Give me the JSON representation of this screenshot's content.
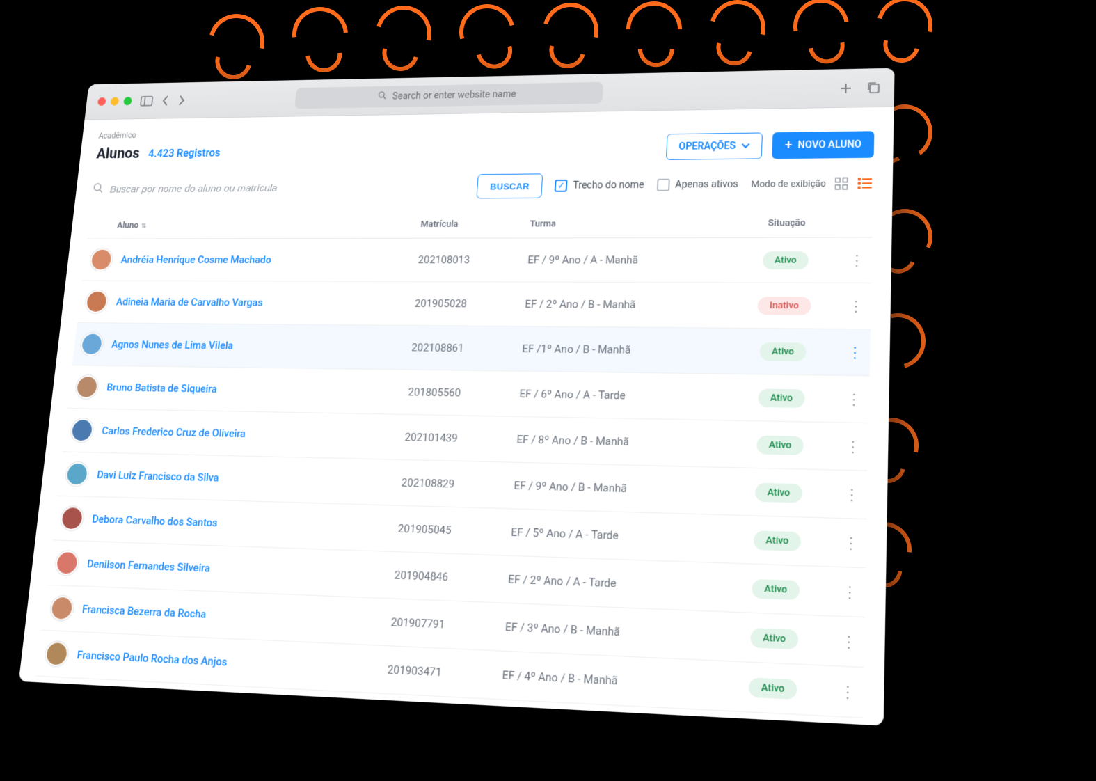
{
  "browser": {
    "address_placeholder": "Search or enter website name"
  },
  "header": {
    "breadcrumb": "Acadêmico",
    "title": "Alunos",
    "count": "4.423 Registros",
    "operations_label": "OPERAÇÕES",
    "new_label": "NOVO ALUNO"
  },
  "toolbar": {
    "search_placeholder": "Buscar por nome do aluno ou matrícula",
    "search_button": "BUSCAR",
    "chk_trecho": "Trecho do nome",
    "chk_ativos": "Apenas ativos",
    "viewmode_label": "Modo de exibição"
  },
  "columns": {
    "aluno": "Aluno",
    "matricula": "Matrícula",
    "turma": "Turma",
    "situacao": "Situação"
  },
  "status_labels": {
    "ativo": "Ativo",
    "inativo": "Inativo"
  },
  "rows": [
    {
      "name": "Andréia Henrique Cosme Machado",
      "matricula": "202108013",
      "turma": "EF / 9º Ano / A - Manhã",
      "status": "ativo",
      "selected": false,
      "avatar": "#d98c6a"
    },
    {
      "name": "Adineia Maria de Carvalho Vargas",
      "matricula": "201905028",
      "turma": "EF / 2º Ano / B - Manhã",
      "status": "inativo",
      "selected": false,
      "avatar": "#c97a52"
    },
    {
      "name": "Agnos Nunes de Lima Vilela",
      "matricula": "202108861",
      "turma": "EF /1º Ano / B - Manhã",
      "status": "ativo",
      "selected": true,
      "avatar": "#6aa8d9"
    },
    {
      "name": "Bruno Batista de Siqueira",
      "matricula": "201805560",
      "turma": "EF / 6º Ano / A - Tarde",
      "status": "ativo",
      "selected": false,
      "avatar": "#b88a6a"
    },
    {
      "name": "Carlos Frederico Cruz de Oliveira",
      "matricula": "202101439",
      "turma": "EF / 8º Ano / B - Manhã",
      "status": "ativo",
      "selected": false,
      "avatar": "#4a7ab0"
    },
    {
      "name": "Davi Luiz Francisco da Silva",
      "matricula": "202108829",
      "turma": "EF / 9º Ano / B - Manhã",
      "status": "ativo",
      "selected": false,
      "avatar": "#5aa7c9"
    },
    {
      "name": "Debora Carvalho dos Santos",
      "matricula": "201905045",
      "turma": "EF / 5º Ano / A - Tarde",
      "status": "ativo",
      "selected": false,
      "avatar": "#a8544c"
    },
    {
      "name": "Denilson Fernandes Silveira",
      "matricula": "201904846",
      "turma": "EF / 2º Ano / A - Tarde",
      "status": "ativo",
      "selected": false,
      "avatar": "#d9786a"
    },
    {
      "name": "Francisca Bezerra da Rocha",
      "matricula": "201907791",
      "turma": "EF / 3º Ano / B - Manhã",
      "status": "ativo",
      "selected": false,
      "avatar": "#c98a6a"
    },
    {
      "name": "Francisco Paulo Rocha dos Anjos",
      "matricula": "201903471",
      "turma": "EF / 4º Ano / B - Manhã",
      "status": "ativo",
      "selected": false,
      "avatar": "#b0885a"
    }
  ]
}
